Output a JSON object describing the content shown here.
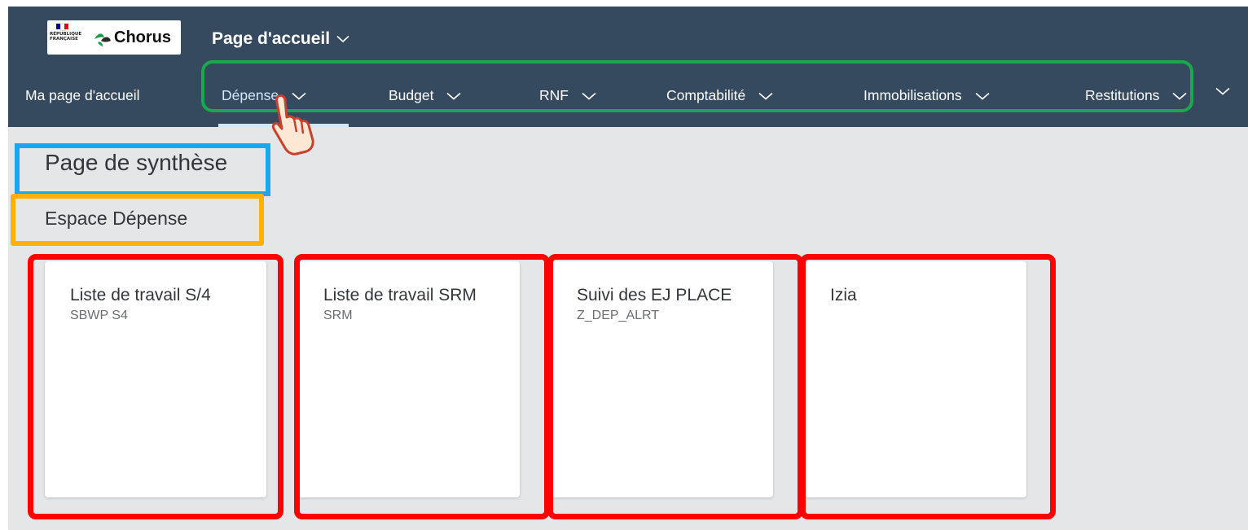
{
  "header": {
    "logo": {
      "flag_text": "RÉPUBLIQUE FRANÇAISE",
      "brand": "Chorus",
      "leaf_icon": "chorus-leaf-icon"
    },
    "app_title": "Page d'accueil",
    "app_title_icon": "chevron-down-icon",
    "nav": {
      "home": "Ma page d'accueil",
      "items": [
        {
          "label": "Dépense",
          "selected": true
        },
        {
          "label": "Budget"
        },
        {
          "label": "RNF"
        },
        {
          "label": "Comptabilité"
        },
        {
          "label": "Immobilisations"
        },
        {
          "label": "Restitutions"
        }
      ],
      "overflow_icon": "chevron-down-icon"
    }
  },
  "page": {
    "title": "Page de synthèse",
    "section_title": "Espace Dépense"
  },
  "tiles": [
    {
      "title": "Liste de travail S/4",
      "subtitle": "SBWP S4"
    },
    {
      "title": "Liste de travail SRM",
      "subtitle": "SRM"
    },
    {
      "title": "Suivi des EJ PLACE",
      "subtitle": "Z_DEP_ALRT"
    },
    {
      "title": "Izia",
      "subtitle": ""
    }
  ],
  "annotations": {
    "nav_highlight_color": "#1aa84c",
    "title_highlight_color": "#18a8ee",
    "section_highlight_color": "#ffb100",
    "tile_highlight_color": "#ff0000",
    "pointer_icon": "hand-pointer-icon"
  },
  "colors": {
    "shell_bar": "#354a5f",
    "background": "#e4e6e8",
    "tile": "#ffffff"
  }
}
